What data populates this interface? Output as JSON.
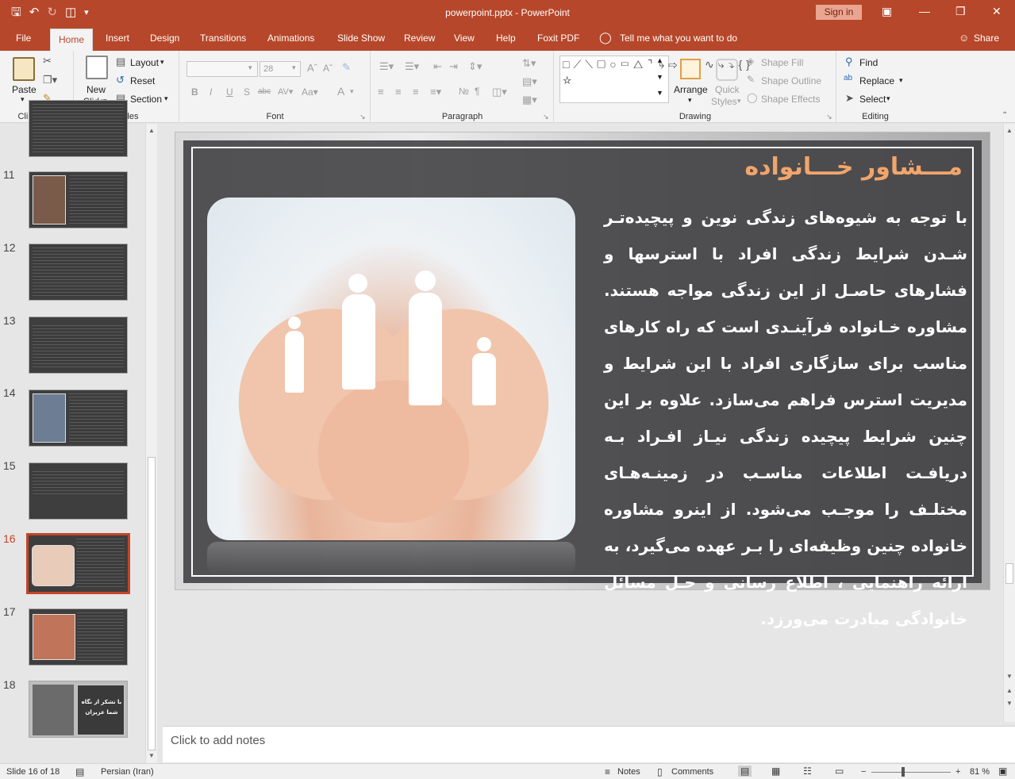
{
  "window": {
    "title": "powerpoint.pptx  -  PowerPoint",
    "sign_in": "Sign in"
  },
  "tabs": [
    "File",
    "Home",
    "Insert",
    "Design",
    "Transitions",
    "Animations",
    "Slide Show",
    "Review",
    "View",
    "Help",
    "Foxit PDF"
  ],
  "tell_me": "Tell me what you want to do",
  "share": "Share",
  "ribbon": {
    "clipboard": {
      "paste": "Paste",
      "label": "Clipboard"
    },
    "slides": {
      "new_slide_1": "New",
      "new_slide_2": "Slide",
      "layout": "Layout",
      "reset": "Reset",
      "section": "Section",
      "label": "Slides"
    },
    "font": {
      "font_size": "28",
      "label": "Font"
    },
    "paragraph": {
      "label": "Paragraph"
    },
    "drawing": {
      "arrange": "Arrange",
      "quick_styles_1": "Quick",
      "quick_styles_2": "Styles",
      "shape_fill": "Shape Fill",
      "shape_outline": "Shape Outline",
      "shape_effects": "Shape Effects",
      "label": "Drawing"
    },
    "editing": {
      "find": "Find",
      "replace": "Replace",
      "select": "Select",
      "label": "Editing"
    }
  },
  "thumbnails": [
    "11",
    "12",
    "13",
    "14",
    "15",
    "16",
    "17",
    "18"
  ],
  "thumb18_text": "با تشکر از نگاه شما عزیزان",
  "slide": {
    "title": "مـــشاور خـــانواده",
    "body": "با توجه به شیوه‌های زندگی نوین و پیچیده‌تـر شـدن شرایط زندگی افراد با استرسها و فشارهای حاصـل از این زندگی مواجه هستند. مشاوره خـانواده فرآینـدی است که راه کارهای مناسب برای سازگاری افراد با این شرایط و مدیریت استرس فراهم می‌سازد. علاوه بر این چنین شرایط پیچیده زندگی نیـاز افـراد بـه دریافـت اطلاعات مناسـب در زمینـه‌هـای مختلـف را موجـب می‌شود. از اینرو مشاوره خانواده چنین وظیفه‌ای را بـر عهده می‌گیرد، به ارائه راهنمایی ، اطلاع رسانی و حـل مسائل خانوادگی مبادرت می‌ورزد."
  },
  "notes_placeholder": "Click to add notes",
  "status": {
    "slide_counter": "Slide 16 of 18",
    "language": "Persian (Iran)",
    "notes": "Notes",
    "comments": "Comments",
    "zoom": "81 %"
  }
}
